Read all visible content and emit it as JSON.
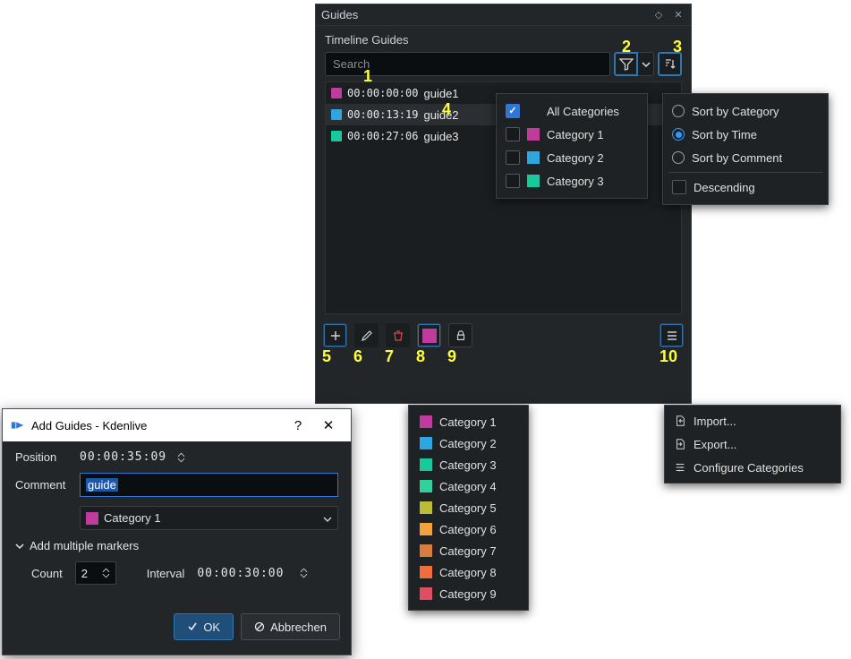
{
  "guides_panel": {
    "title": "Guides",
    "subtitle": "Timeline Guides",
    "search_placeholder": "Search",
    "guides": [
      {
        "color": "#c13a9e",
        "time": "00:00:00:00",
        "name": "guide1"
      },
      {
        "color": "#2da7dd",
        "time": "00:00:13:19",
        "name": "guide2"
      },
      {
        "color": "#19c89b",
        "time": "00:00:27:06",
        "name": "guide3"
      }
    ],
    "current_category_color": "#c13a9e"
  },
  "annotations": {
    "n1": "1",
    "n2": "2",
    "n3": "3",
    "n4": "4",
    "n5": "5",
    "n6": "6",
    "n7": "7",
    "n8": "8",
    "n9": "9",
    "n10": "10"
  },
  "filter_popup": {
    "all": "All Categories",
    "items": [
      {
        "label": "Category 1",
        "color": "#c13a9e"
      },
      {
        "label": "Category 2",
        "color": "#2da7dd"
      },
      {
        "label": "Category 3",
        "color": "#19c89b"
      }
    ]
  },
  "sort_popup": {
    "by_category": "Sort by Category",
    "by_time": "Sort by Time",
    "by_comment": "Sort by Comment",
    "descending": "Descending"
  },
  "catlist_popup": {
    "items": [
      {
        "label": "Category 1",
        "color": "#c13a9e"
      },
      {
        "label": "Category 2",
        "color": "#2da7dd"
      },
      {
        "label": "Category 3",
        "color": "#19c89b"
      },
      {
        "label": "Category 4",
        "color": "#2fd29a"
      },
      {
        "label": "Category 5",
        "color": "#bdbc3a"
      },
      {
        "label": "Category 6",
        "color": "#f2a23c"
      },
      {
        "label": "Category 7",
        "color": "#d97d3c"
      },
      {
        "label": "Category 8",
        "color": "#f06d3c"
      },
      {
        "label": "Category 9",
        "color": "#e14e63"
      }
    ]
  },
  "hamburger_menu": {
    "import": "Import...",
    "export": "Export...",
    "configure": "Configure Categories"
  },
  "dialog": {
    "title": "Add Guides - Kdenlive",
    "position_label": "Position",
    "position_value": "00:00:35:09",
    "comment_label": "Comment",
    "comment_value": "guide",
    "category_label": "Category 1",
    "category_color": "#c13a9e",
    "expander_label": "Add multiple markers",
    "count_label": "Count",
    "count_value": "2",
    "interval_label": "Interval",
    "interval_value": "00:00:30:00",
    "ok_label": "OK",
    "cancel_label": "Abbrechen"
  }
}
